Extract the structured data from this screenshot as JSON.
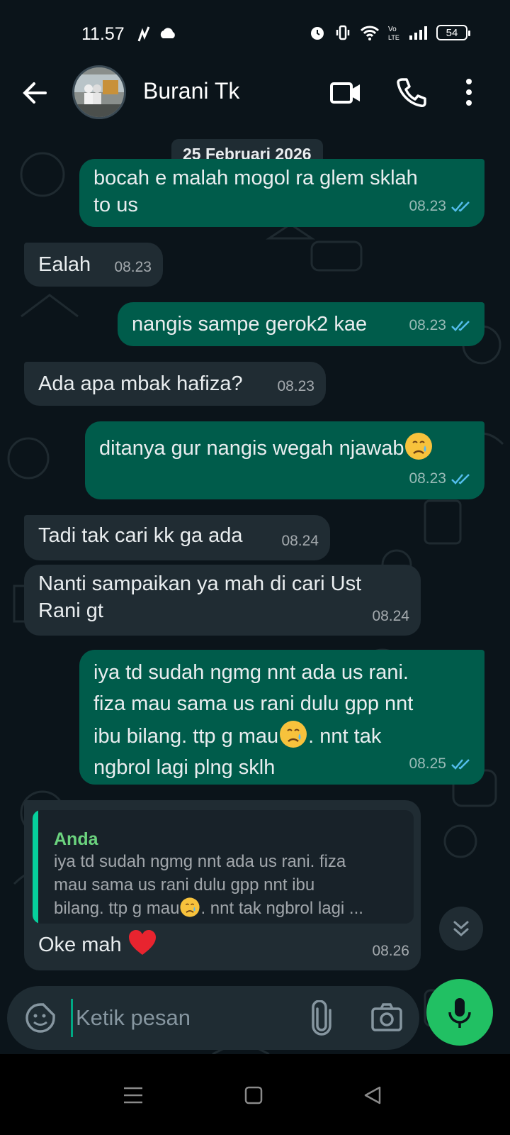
{
  "status_bar": {
    "time": "11.57",
    "battery": "54"
  },
  "header": {
    "contact_name": "Burani Tk"
  },
  "date_chip": "25 Februari 2026",
  "messages": [
    {
      "dir": "out",
      "text_lines": [
        "bocah e malah mogol ra glem sklah",
        "to us"
      ],
      "time": "08.23",
      "read": true
    },
    {
      "dir": "in",
      "text": "Ealah",
      "time": "08.23"
    },
    {
      "dir": "out",
      "text": "nangis sampe gerok2 kae",
      "time": "08.23",
      "read": true
    },
    {
      "dir": "in",
      "text": "Ada apa mbak hafiza?",
      "time": "08.23"
    },
    {
      "dir": "out",
      "text": "ditanya gur nangis wegah njawab",
      "emoji": "crying-face",
      "time": "08.23",
      "read": true
    },
    {
      "dir": "in",
      "text": "Tadi tak cari kk ga ada",
      "time": "08.24"
    },
    {
      "dir": "in",
      "text_lines": [
        "Nanti sampaikan ya mah di cari Ust",
        "Rani gt"
      ],
      "time": "08.24"
    },
    {
      "dir": "out",
      "text_lines": [
        "iya td sudah ngmg nnt ada us rani.",
        "fiza mau sama us rani dulu gpp nnt",
        "ibu bilang. ttp g mau",
        ". nnt tak",
        "ngbrol lagi plng sklh"
      ],
      "time": "08.25",
      "read": true
    },
    {
      "dir": "in",
      "quote": {
        "author": "Anda",
        "lines": [
          "iya td sudah ngmg nnt ada us rani. fiza",
          "mau sama us rani dulu gpp nnt ibu",
          "bilang. ttp g mau",
          ". nnt tak ngbrol lagi ..."
        ]
      },
      "text": "Oke mah",
      "emoji": "red-heart",
      "time": "08.26"
    }
  ],
  "input": {
    "placeholder": "Ketik pesan"
  },
  "colors": {
    "outgoing_bubble": "#005c4b",
    "incoming_bubble": "#202c33",
    "background": "#0b141a",
    "accent": "#21c063",
    "read_ticks": "#53bdeb"
  }
}
